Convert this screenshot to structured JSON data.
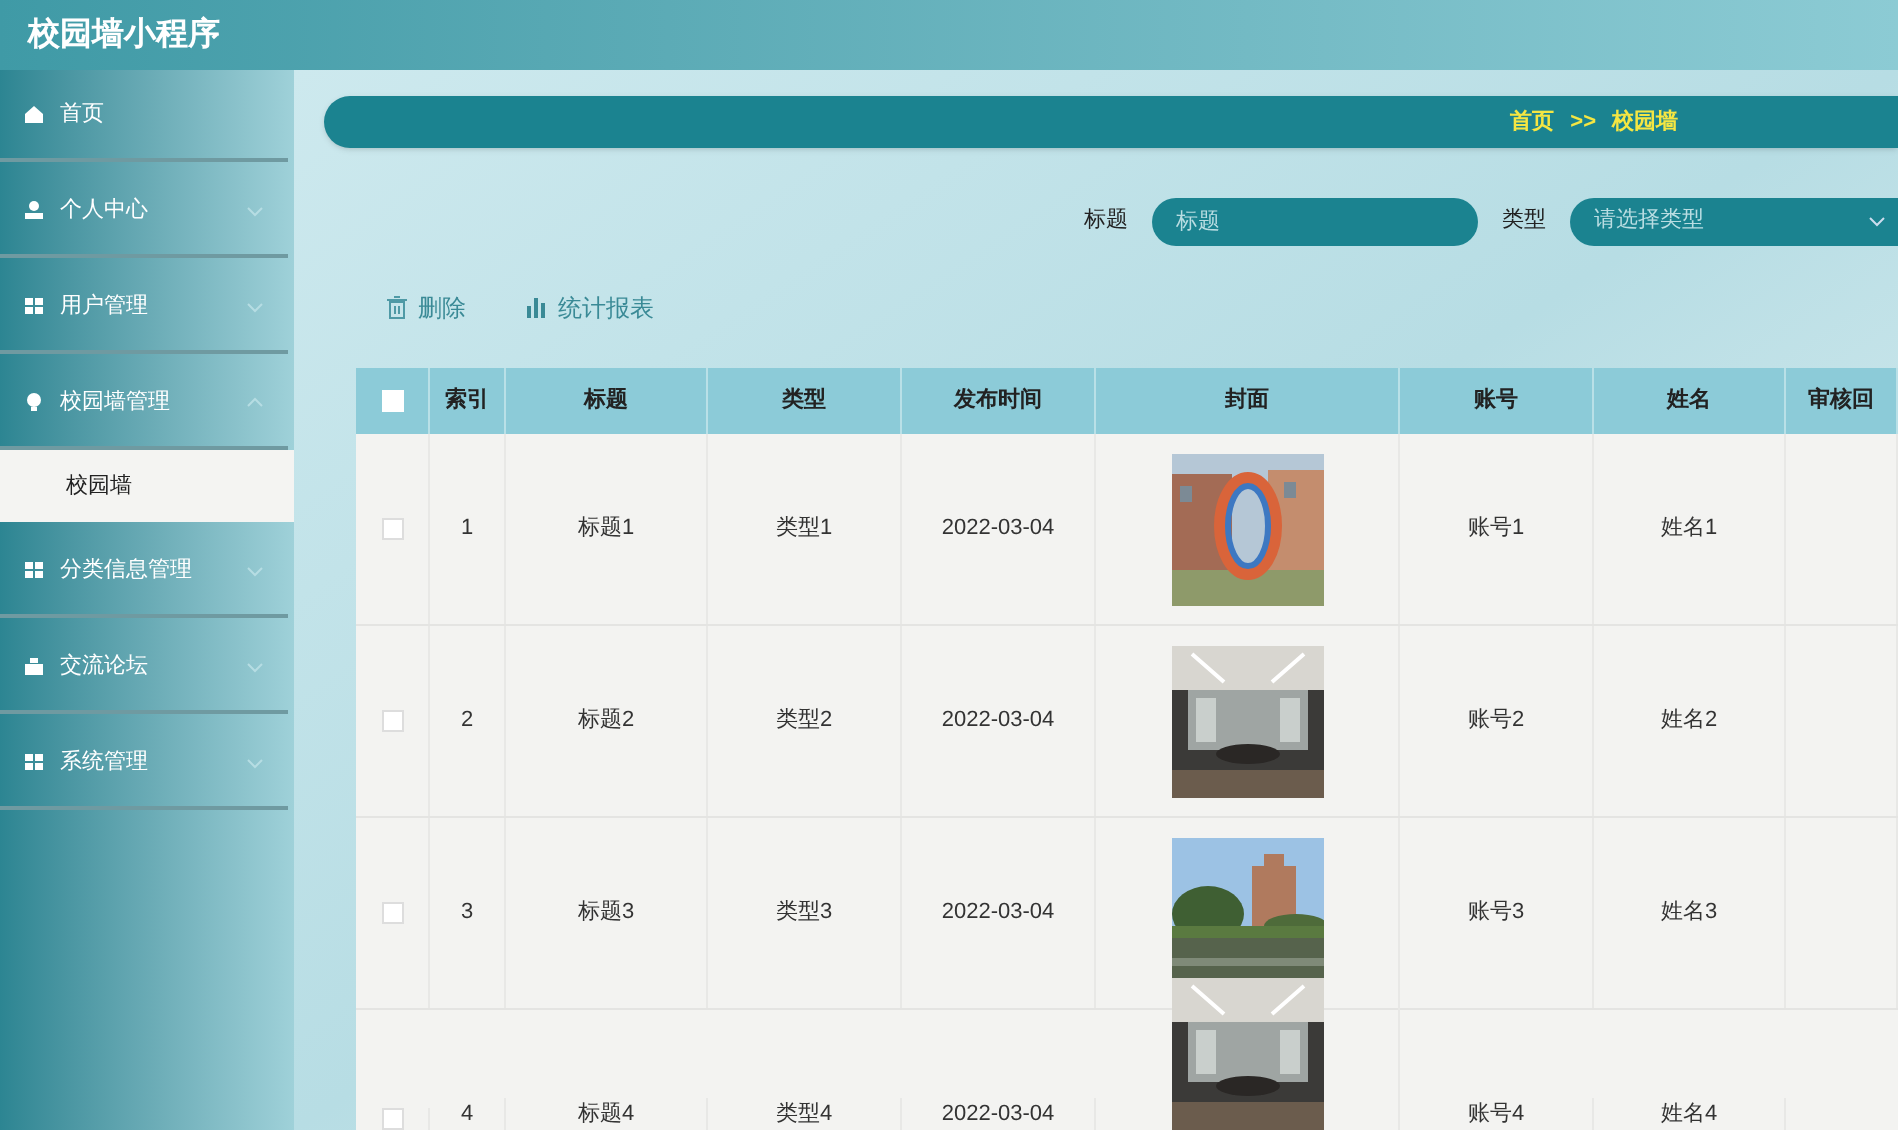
{
  "app_title": "校园墙小程序",
  "sidebar": {
    "items": [
      {
        "label": "首页"
      },
      {
        "label": "个人中心",
        "expanded": false
      },
      {
        "label": "用户管理",
        "expanded": false
      },
      {
        "label": "校园墙管理",
        "expanded": true,
        "children": [
          {
            "label": "校园墙",
            "selected": true
          }
        ]
      },
      {
        "label": "分类信息管理",
        "expanded": false
      },
      {
        "label": "交流论坛",
        "expanded": false
      },
      {
        "label": "系统管理",
        "expanded": false
      }
    ]
  },
  "breadcrumb": [
    "首页",
    ">>",
    "校园墙"
  ],
  "search": [
    {
      "label": "标题",
      "kind": "input",
      "placeholder": "标题"
    },
    {
      "label": "类型",
      "kind": "select",
      "placeholder": "请选择类型"
    }
  ],
  "actions": [
    "删除",
    "统计报表"
  ],
  "table": {
    "header_checked": false,
    "columns": [
      "索引",
      "标题",
      "类型",
      "发布时间",
      "封面",
      "账号",
      "姓名",
      "审核回"
    ],
    "rows": [
      {
        "checked": false,
        "cells": [
          "1",
          "标题1",
          "类型1",
          "2022-03-04",
          "",
          "账号1",
          "姓名1"
        ],
        "cover": {
          "kind": "picture"
        }
      },
      {
        "checked": false,
        "cells": [
          "2",
          "标题2",
          "类型2",
          "2022-03-04",
          "",
          "账号2",
          "姓名2"
        ],
        "cover": {
          "kind": "picture"
        }
      },
      {
        "checked": false,
        "cells": [
          "3",
          "标题3",
          "类型3",
          "2022-03-04",
          "",
          "账号3",
          "姓名3"
        ],
        "cover": {
          "kind": "picture"
        }
      },
      {
        "checked": false,
        "cells": [
          "4",
          "标题4",
          "类型4",
          "2022-03-04",
          "",
          "账号4",
          "姓名4"
        ],
        "cover": {
          "kind": "picture"
        }
      }
    ]
  }
}
